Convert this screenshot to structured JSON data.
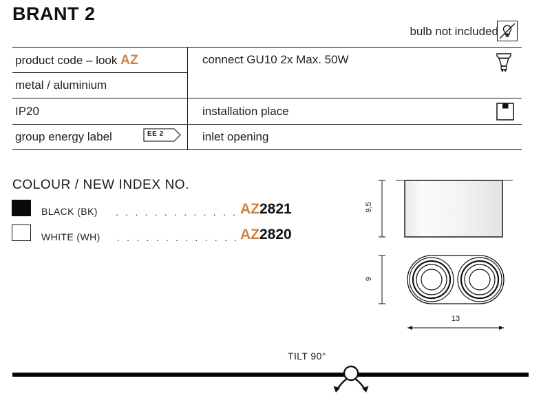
{
  "header": {
    "title": "BRANT 2",
    "bulb_note": "bulb not included",
    "bulb_icon": "bulb-crossed-out-icon"
  },
  "spec_table": {
    "rows": [
      {
        "left": "product code – look ",
        "left_accent": "AZ",
        "right": "connect GU10 2x Max. 50W",
        "right_icon": "gu10-lamp-icon"
      },
      {
        "left": "metal / aluminium",
        "right": "",
        "right_icon": ""
      },
      {
        "left": "IP20",
        "right": "installation place",
        "right_icon": "ceiling-mount-icon"
      },
      {
        "left": "group energy label",
        "left_badge": "EE 2",
        "right": "inlet opening",
        "right_icon": ""
      }
    ]
  },
  "colour_section": {
    "heading": "COLOUR / NEW INDEX NO.",
    "items": [
      {
        "swatch": "black",
        "name": "BLACK (BK)",
        "dots": ". . . . . . . . . . . . .",
        "prefix": "AZ",
        "number": "2821"
      },
      {
        "swatch": "white",
        "name": "WHITE (WH)",
        "dots": ". . . . . . . . . . . . .",
        "prefix": "AZ",
        "number": "2820"
      }
    ]
  },
  "drawing": {
    "height_label": "9,5",
    "depth_label": "9",
    "width_label": "13",
    "side_view_name": "side-view",
    "bottom_view_name": "bottom-view"
  },
  "tilt": {
    "label": "TILT 90°"
  },
  "colors": {
    "accent_orange": "#CE8240",
    "ink": "#111111"
  }
}
